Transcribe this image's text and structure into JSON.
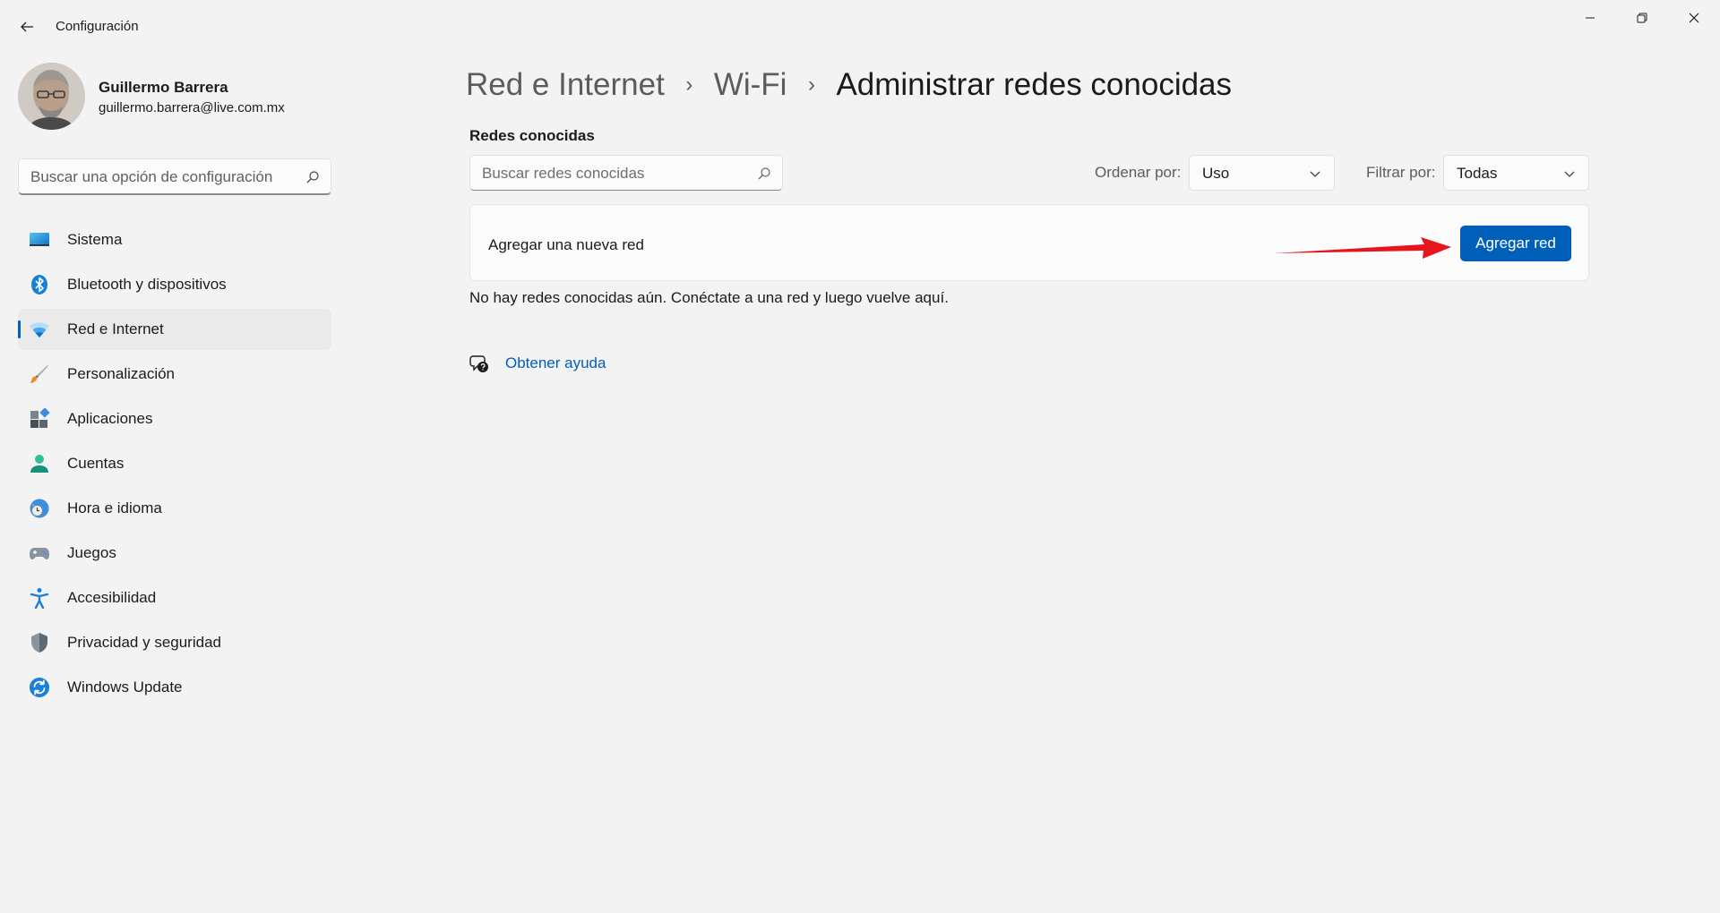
{
  "window": {
    "title": "Configuración"
  },
  "profile": {
    "name": "Guillermo Barrera",
    "email": "guillermo.barrera@live.com.mx"
  },
  "sidebar": {
    "search_placeholder": "Buscar una opción de configuración",
    "items": [
      {
        "label": "Sistema",
        "icon": "system-icon",
        "active": false
      },
      {
        "label": "Bluetooth y dispositivos",
        "icon": "bluetooth-icon",
        "active": false
      },
      {
        "label": "Red e Internet",
        "icon": "wifi-icon",
        "active": true
      },
      {
        "label": "Personalización",
        "icon": "brush-icon",
        "active": false
      },
      {
        "label": "Aplicaciones",
        "icon": "apps-icon",
        "active": false
      },
      {
        "label": "Cuentas",
        "icon": "person-icon",
        "active": false
      },
      {
        "label": "Hora e idioma",
        "icon": "clock-globe-icon",
        "active": false
      },
      {
        "label": "Juegos",
        "icon": "gamepad-icon",
        "active": false
      },
      {
        "label": "Accesibilidad",
        "icon": "accessibility-icon",
        "active": false
      },
      {
        "label": "Privacidad y seguridad",
        "icon": "shield-icon",
        "active": false
      },
      {
        "label": "Windows Update",
        "icon": "update-icon",
        "active": false
      }
    ]
  },
  "breadcrumb": {
    "items": [
      "Red e Internet",
      "Wi-Fi"
    ],
    "current": "Administrar redes conocidas",
    "separator": "›"
  },
  "main": {
    "section_title": "Redes conocidas",
    "search_placeholder": "Buscar redes conocidas",
    "sort_label": "Ordenar por:",
    "sort_value": "Uso",
    "filter_label": "Filtrar por:",
    "filter_value": "Todas",
    "add_card_label": "Agregar una nueva red",
    "add_button_label": "Agregar red",
    "empty_message": "No hay redes conocidas aún. Conéctate a una red y luego vuelve aquí.",
    "help_link": "Obtener ayuda"
  },
  "colors": {
    "accent": "#005fb8",
    "background": "#f3f3f3",
    "annotation_arrow": "#e8141b"
  }
}
